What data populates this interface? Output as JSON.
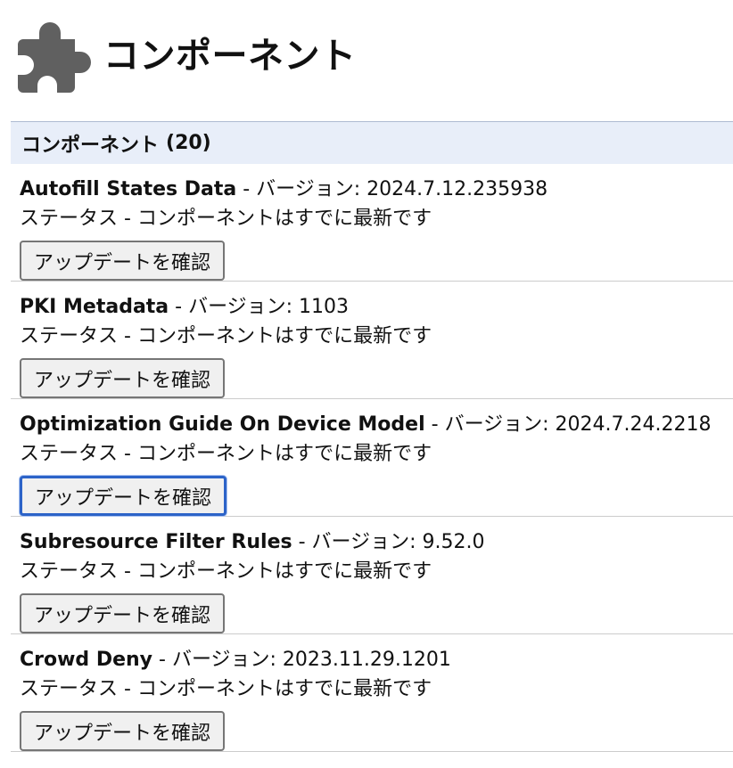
{
  "page": {
    "title": "コンポーネント"
  },
  "section": {
    "label": "コンポーネント",
    "count": "(20)"
  },
  "version_separator": " - バージョン: ",
  "status_prefix": "ステータス - ",
  "components": [
    {
      "name": "Autofill States Data",
      "version": "2024.7.12.235938",
      "status": "コンポーネントはすでに最新です",
      "button_label": "アップデートを確認"
    },
    {
      "name": "PKI Metadata",
      "version": "1103",
      "status": "コンポーネントはすでに最新です",
      "button_label": "アップデートを確認"
    },
    {
      "name": "Optimization Guide On Device Model",
      "version": "2024.7.24.2218",
      "status": "コンポーネントはすでに最新です",
      "button_label": "アップデートを確認",
      "focused": true
    },
    {
      "name": "Subresource Filter Rules",
      "version": "9.52.0",
      "status": "コンポーネントはすでに最新です",
      "button_label": "アップデートを確認"
    },
    {
      "name": "Crowd Deny",
      "version": "2023.11.29.1201",
      "status": "コンポーネントはすでに最新です",
      "button_label": "アップデートを確認"
    }
  ],
  "colors": {
    "section_bg": "#e8eef9",
    "focus_ring": "#2c63c8",
    "icon_fill": "#606060"
  },
  "icons": {
    "header": "puzzle-piece-icon"
  }
}
